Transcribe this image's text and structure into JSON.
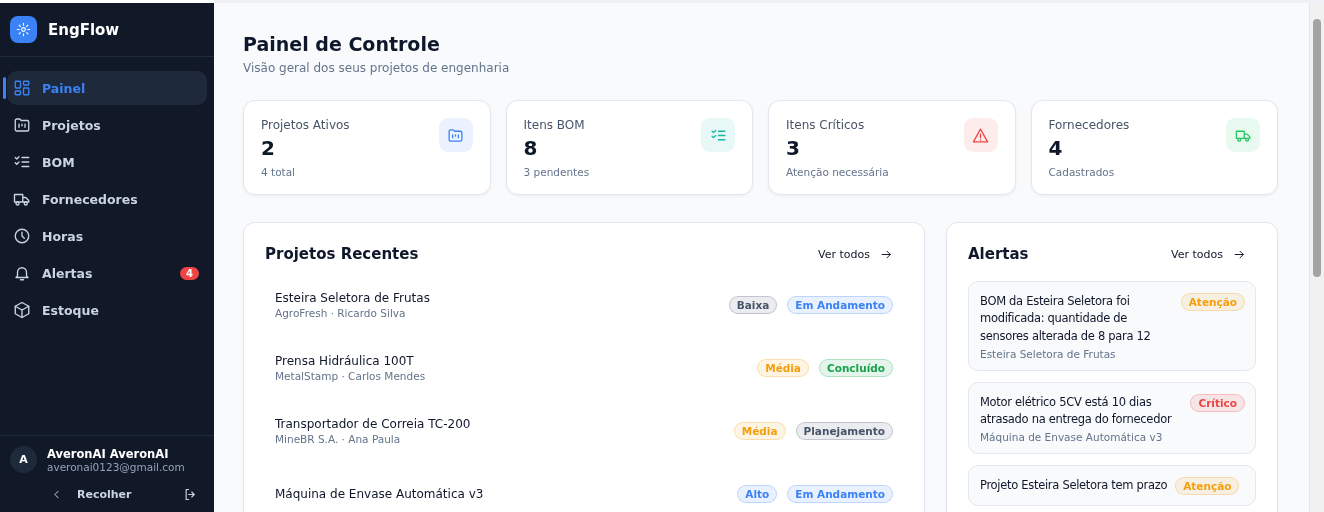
{
  "sidebar": {
    "brand": "EngFlow",
    "items": [
      {
        "kind": "grid",
        "label": "Painel",
        "selected": true
      },
      {
        "kind": "folder",
        "label": "Projetos",
        "selected": false
      },
      {
        "kind": "checklist",
        "label": "BOM",
        "selected": false
      },
      {
        "kind": "truck",
        "label": "Fornecedores",
        "selected": false
      },
      {
        "kind": "clock",
        "label": "Horas",
        "selected": false
      },
      {
        "kind": "bell",
        "label": "Alertas",
        "selected": false,
        "badge": "4"
      },
      {
        "kind": "box",
        "label": "Estoque",
        "selected": false
      }
    ],
    "user": {
      "initial": "A",
      "name": "AveronAI AveronAI",
      "email": "averonai0123@gmail.com"
    },
    "collapse": "Recolher"
  },
  "header": {
    "title": "Painel de Controle",
    "subtitle": "Visão geral dos seus projetos de engenharia"
  },
  "stats": [
    {
      "label": "Projetos Ativos",
      "value": "2",
      "note": "4 total",
      "kind": "folder",
      "color": "#3b82f6"
    },
    {
      "label": "Itens BOM",
      "value": "8",
      "note": "3 pendentes",
      "kind": "checklist",
      "color": "#14b8a6"
    },
    {
      "label": "Itens Críticos",
      "value": "3",
      "note": "Atenção necessária",
      "kind": "warning",
      "color": "#ef4444"
    },
    {
      "label": "Fornecedores",
      "value": "4",
      "note": "Cadastrados",
      "kind": "truck",
      "color": "#22c55e"
    }
  ],
  "recent_projects": {
    "title": "Projetos Recentes",
    "link": "Ver todos",
    "rows": [
      {
        "name": "Esteira Seletora de Frutas",
        "meta": "AgroFresh · Ricardo Silva",
        "badges": [
          {
            "text": "Baixa",
            "color": "#475569"
          },
          {
            "text": "Em Andamento",
            "color": "#3b82f6"
          }
        ]
      },
      {
        "name": "Prensa Hidráulica 100T",
        "meta": "MetalStamp · Carlos Mendes",
        "badges": [
          {
            "text": "Média",
            "color": "#f59e0b"
          },
          {
            "text": "Concluído",
            "color": "#16a34a"
          }
        ]
      },
      {
        "name": "Transportador de Correia TC-200",
        "meta": "MineBR S.A. · Ana Paula",
        "badges": [
          {
            "text": "Média",
            "color": "#f59e0b"
          },
          {
            "text": "Planejamento",
            "color": "#475569"
          }
        ]
      },
      {
        "name": "Máquina de Envase Automática v3",
        "badges": [
          {
            "text": "Alto",
            "color": "#3b82f6"
          },
          {
            "text": "Em Andamento",
            "color": "#3b82f6"
          }
        ]
      }
    ]
  },
  "alerts": {
    "title": "Alertas",
    "link": "Ver todos",
    "items": [
      {
        "message": "BOM da Esteira Seletora foi modificada: quantidade de sensores alterada de 8 para 12",
        "project": "Esteira Seletora de Frutas",
        "badge": "Atenção",
        "color": "#f59e0b"
      },
      {
        "message": "Motor elétrico 5CV está 10 dias atrasado na entrega do fornecedor",
        "project": "Máquina de Envase Automática v3",
        "badge": "Crítico",
        "color": "#ef4444"
      },
      {
        "message": "Projeto Esteira Seletora tem prazo",
        "badge": "Atenção",
        "color": "#f59e0b"
      }
    ]
  }
}
